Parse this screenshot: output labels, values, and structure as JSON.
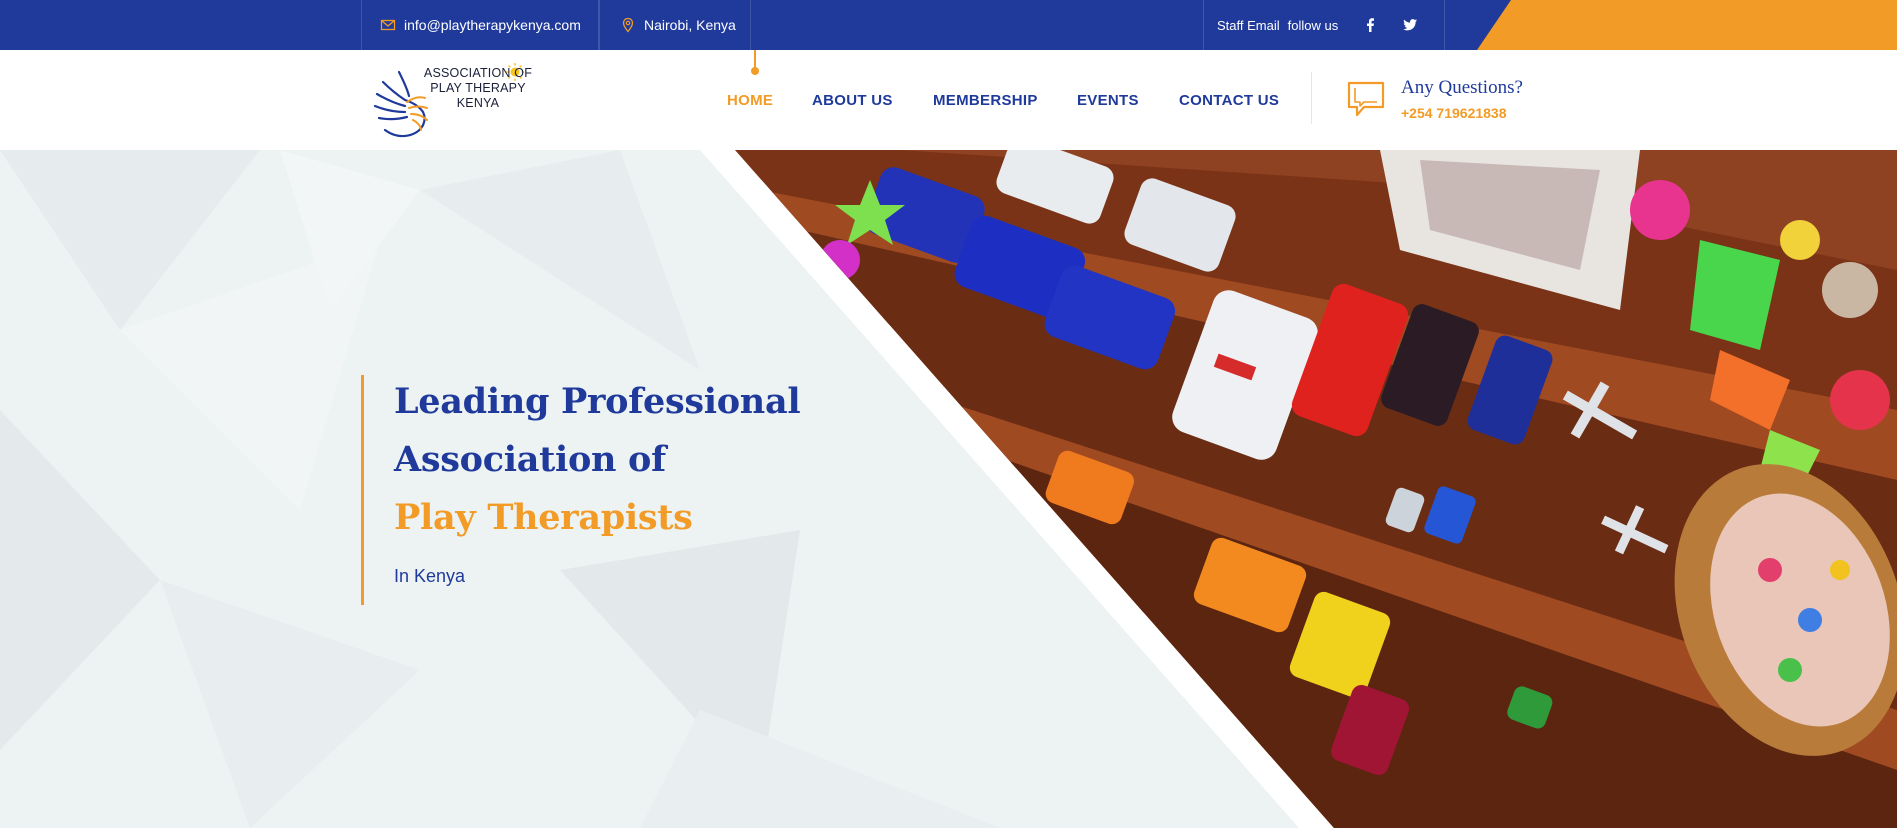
{
  "topbar": {
    "email": "info@playtherapykenya.com",
    "location": "Nairobi, Kenya",
    "staff_email": "Staff Email",
    "follow_us": "follow us",
    "email_icon": "envelope-icon",
    "location_icon": "map-pin-icon",
    "social": [
      "facebook-icon",
      "twitter-icon"
    ]
  },
  "logo": {
    "line1": "ASSOCIATION OF",
    "line2": "PLAY THERAPY",
    "line3": "KENYA"
  },
  "nav": {
    "items": [
      {
        "label": "HOME",
        "active": true
      },
      {
        "label": "ABOUT US",
        "active": false
      },
      {
        "label": "MEMBERSHIP",
        "active": false
      },
      {
        "label": "EVENTS",
        "active": false
      },
      {
        "label": "CONTACT US",
        "active": false
      }
    ]
  },
  "contact": {
    "title": "Any Questions?",
    "phone": "+254 719621838",
    "icon": "chat-bubble-icon"
  },
  "hero": {
    "line1": "Leading Professional",
    "line2": "Association of",
    "line3": "Play Therapists",
    "subtitle": "In Kenya"
  },
  "colors": {
    "primary": "#1f3a9b",
    "accent": "#f29b26",
    "hero_bg": "#edf2f3",
    "shelf": "#8a3a1a"
  }
}
